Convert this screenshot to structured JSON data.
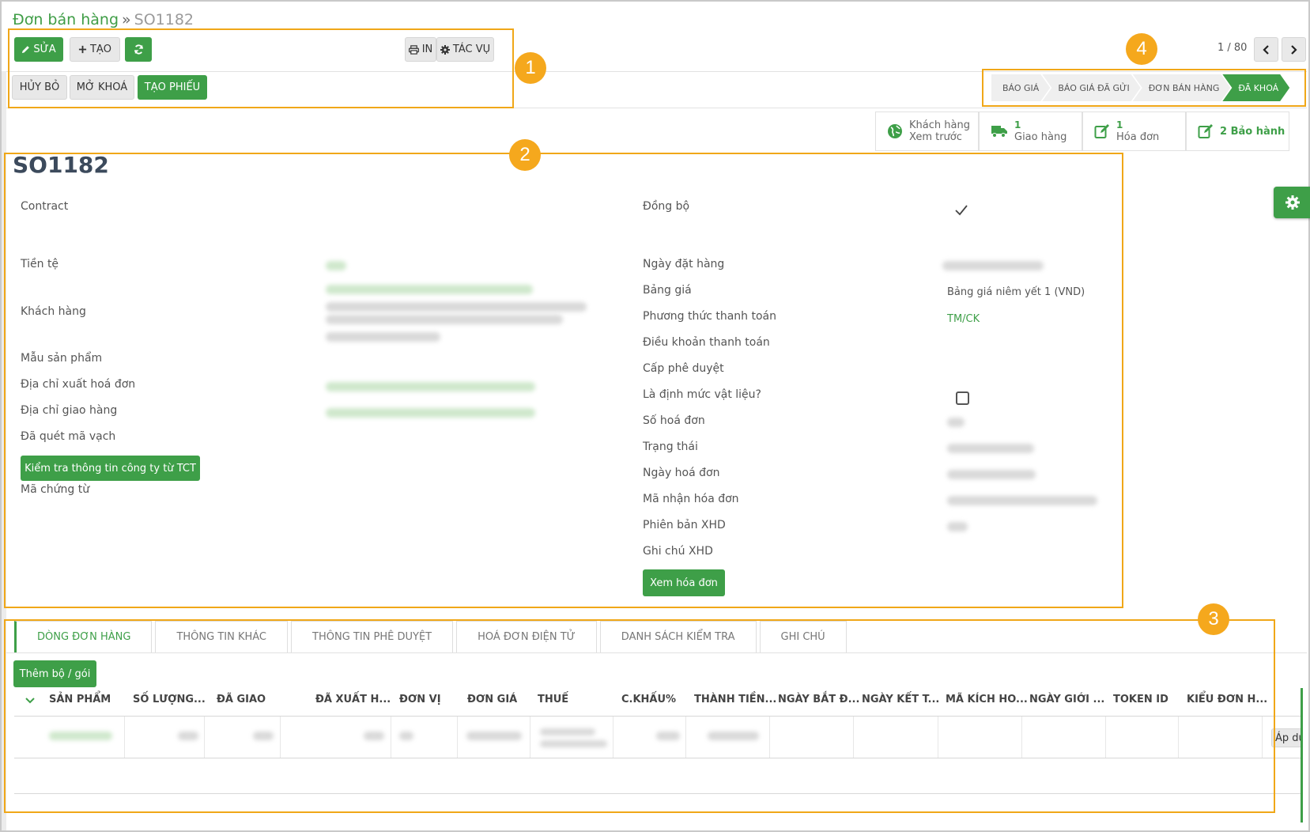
{
  "breadcrumb": {
    "parent": "Đơn bán hàng",
    "separator": "»",
    "current": "SO1182"
  },
  "toolbar": {
    "edit_label": "SỬA",
    "create_label": "TẠO",
    "print_label": "IN",
    "action_label": "TÁC VỤ",
    "cancel_label": "HỦY BỎ",
    "unlock_label": "MỞ KHOÁ",
    "create_ticket_label": "TẠO PHIẾU"
  },
  "pager": {
    "text": "1 / 80"
  },
  "status_steps": [
    "BÁO GIÁ",
    "BÁO GIÁ ĐÃ GỬI",
    "ĐƠN BÁN HÀNG",
    "ĐÃ KHOÁ"
  ],
  "active_status": "ĐÃ KHOÁ",
  "smart_buttons": {
    "customer": {
      "line1": "Khách hàng",
      "line2": "Xem trước"
    },
    "delivery": {
      "count": "1",
      "label": "Giao hàng"
    },
    "invoice": {
      "count": "1",
      "label": "Hóa đơn"
    },
    "warranty": {
      "label": "2 Bảo hành"
    }
  },
  "form": {
    "title": "SO1182",
    "left_labels": {
      "contract": "Contract",
      "currency": "Tiền tệ",
      "customer": "Khách hàng",
      "product_template": "Mẫu sản phẩm",
      "invoice_address": "Địa chỉ xuất hoá đơn",
      "delivery_address": "Địa chỉ giao hàng",
      "barcode_scanned": "Đã quét mã vạch",
      "document_code": "Mã chứng từ"
    },
    "check_company_button": "Kiểm tra thông tin công ty từ TCT",
    "right_labels": {
      "sync": "Đồng bộ",
      "order_date": "Ngày đặt hàng",
      "pricelist": "Bảng giá",
      "payment_method": "Phương thức thanh toán",
      "payment_terms": "Điều khoản thanh toán",
      "approval_level": "Cấp phê duyệt",
      "is_material_norm": "Là định mức vật liệu?",
      "invoice_number": "Số hoá đơn",
      "status": "Trạng thái",
      "invoice_date": "Ngày hoá đơn",
      "invoice_receive_code": "Mã nhận hóa đơn",
      "xhd_version": "Phiên bản XHD",
      "xhd_note": "Ghi chú XHD"
    },
    "pricelist_value": "Bảng giá niêm yết 1 (VND)",
    "payment_method_value": "TM/CK",
    "view_invoice_button": "Xem hóa đơn"
  },
  "tabs": [
    "DÒNG ĐƠN HÀNG",
    "THÔNG TIN KHÁC",
    "THÔNG TIN PHÊ DUYỆT",
    "HOÁ ĐƠN ĐIỆN TỬ",
    "DANH SÁCH KIỂM TRA",
    "GHI CHÚ"
  ],
  "add_bundle_button": "Thêm bộ / gói",
  "table_headers": [
    "SẢN PHẨM",
    "SỐ LƯỢNG...",
    "ĐÃ GIAO",
    "ĐÃ XUẤT H...",
    "ĐƠN VỊ",
    "ĐƠN GIÁ",
    "THUẾ",
    "C.KHẤU%",
    "THÀNH TIỀN...",
    "NGÀY BẮT Đ...",
    "NGÀY KẾT T...",
    "MÃ KÍCH HO...",
    "NGÀY GIỚI ...",
    "TOKEN ID",
    "KIỂU ĐƠN H..."
  ],
  "apply_button": "Áp dụ",
  "annotations": [
    "1",
    "2",
    "3",
    "4"
  ],
  "colors": {
    "accent": "#3e9f48",
    "annotation": "#f0a718"
  }
}
